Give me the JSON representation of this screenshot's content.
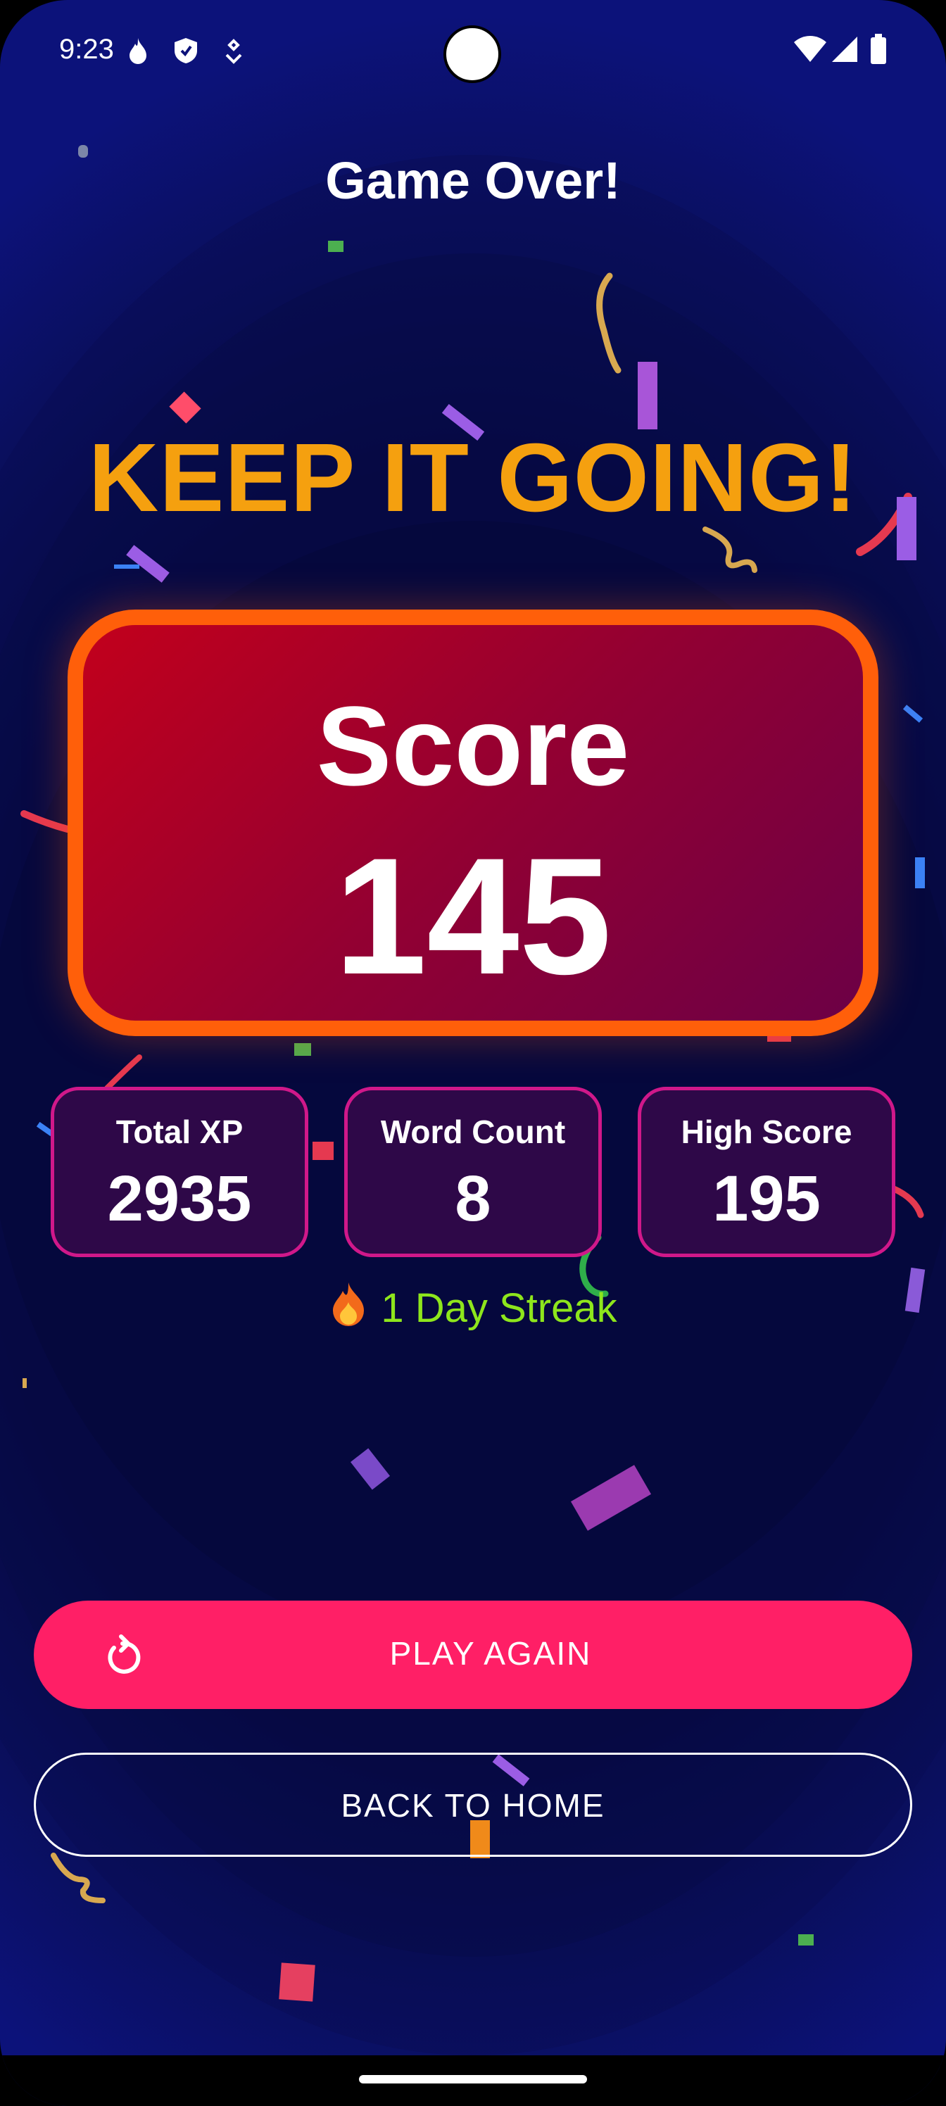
{
  "status_bar": {
    "time": "9:23",
    "left_icons": [
      "fire-icon",
      "shield-icon",
      "heartbeat-icon"
    ],
    "right_icons": [
      "wifi-icon",
      "signal-icon",
      "battery-icon"
    ]
  },
  "header": {
    "title": "Game Over!"
  },
  "headline": "KEEP IT GOING!",
  "score": {
    "label": "Score",
    "value": "145"
  },
  "stats": [
    {
      "label": "Total XP",
      "value": "2935"
    },
    {
      "label": "Word Count",
      "value": "8"
    },
    {
      "label": "High Score",
      "value": "195"
    }
  ],
  "streak": {
    "icon": "fire-icon",
    "text": "1 Day Streak"
  },
  "actions": {
    "play_again": "PLAY AGAIN",
    "back_to_home": "BACK TO HOME"
  },
  "colors": {
    "background": "#050838",
    "headline": "#f5a00f",
    "score_border": "#ff5f0a",
    "stat_border": "#d0188a",
    "streak": "#8ee61c",
    "primary_button": "#ff1f66"
  }
}
